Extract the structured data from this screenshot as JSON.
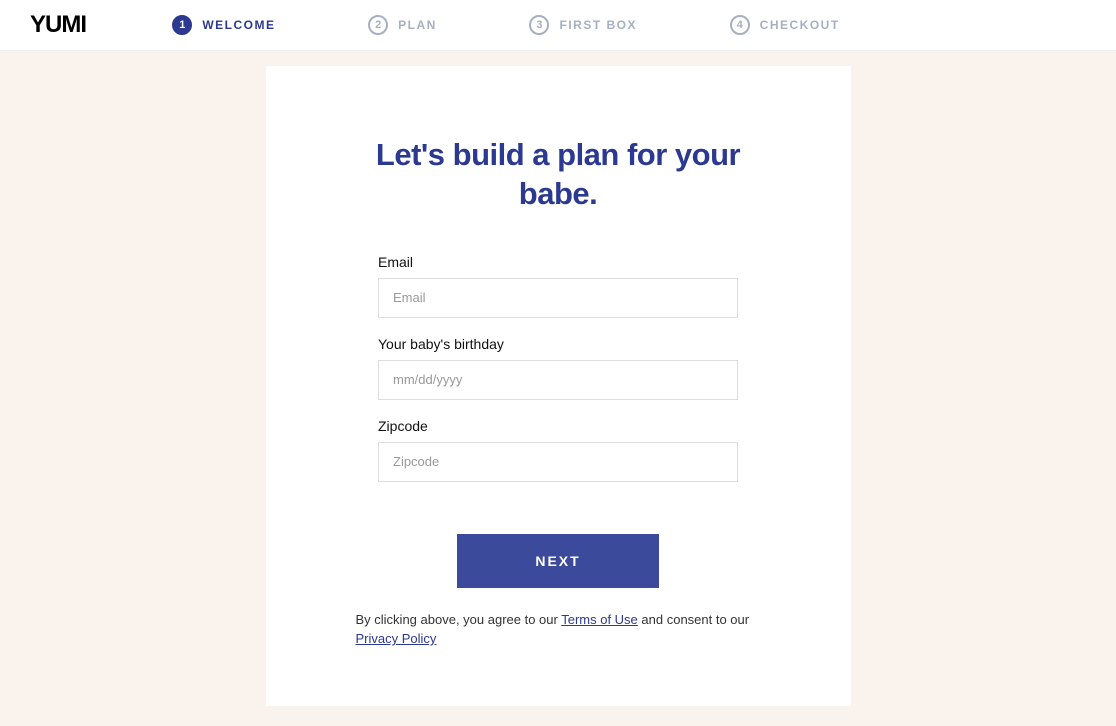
{
  "brand": "YUMI",
  "steps": [
    {
      "num": "1",
      "label": "WELCOME",
      "active": true
    },
    {
      "num": "2",
      "label": "PLAN",
      "active": false
    },
    {
      "num": "3",
      "label": "FIRST BOX",
      "active": false
    },
    {
      "num": "4",
      "label": "CHECKOUT",
      "active": false
    }
  ],
  "headline": "Let's build a plan for your babe.",
  "form": {
    "email": {
      "label": "Email",
      "placeholder": "Email",
      "value": ""
    },
    "birthday": {
      "label": "Your baby's birthday",
      "placeholder": "mm/dd/yyyy",
      "value": ""
    },
    "zipcode": {
      "label": "Zipcode",
      "placeholder": "Zipcode",
      "value": ""
    }
  },
  "next_label": "NEXT",
  "legal": {
    "prefix": "By clicking above, you agree to our ",
    "terms": "Terms of Use",
    "mid": " and consent to our ",
    "privacy": "Privacy Policy"
  }
}
